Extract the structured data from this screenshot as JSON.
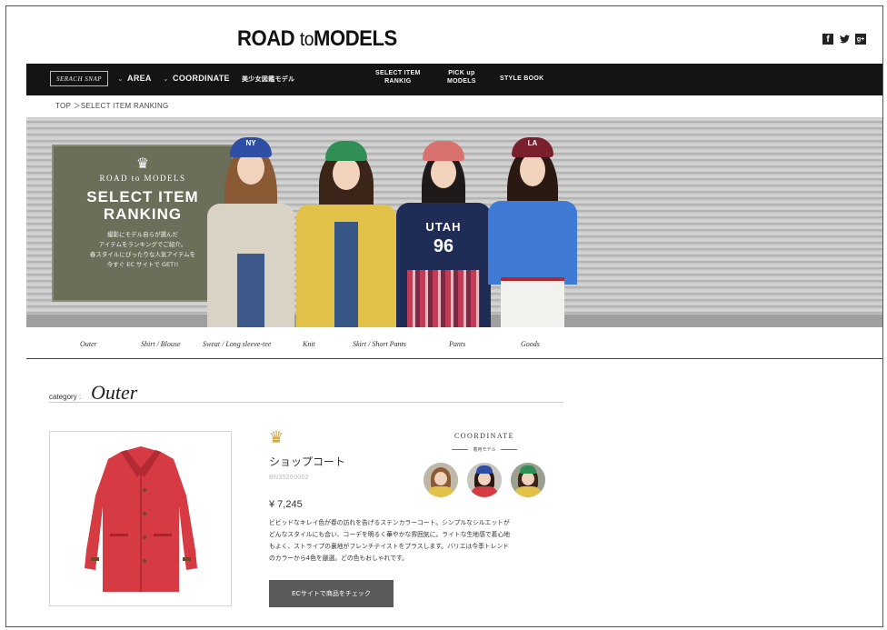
{
  "header": {
    "logo_main": "ROAD",
    "logo_to": "to",
    "logo_end": "MODELS",
    "social": [
      "facebook-icon",
      "twitter-icon",
      "google-plus-icon"
    ],
    "social_glyphs": {
      "facebook": "f",
      "twitter": "🐦",
      "google": "g+"
    }
  },
  "nav": {
    "search_label": "SERACH SNAP",
    "area": "AREA",
    "coordinate": "COORDINATE",
    "pictorial": "美少女図鑑モデル",
    "select_item_line1": "SELECT ITEM",
    "select_item_line2": "RANKIG",
    "pickup_line1": "PICK up",
    "pickup_line2": "MODELS",
    "style_book": "STYLE BOOK"
  },
  "breadcrumb": "TOP ＞SELECT ITEM RANKING",
  "hero": {
    "brand": "ROAD to MODELS",
    "title_line1": "SELECT ITEM",
    "title_line2": "RANKING",
    "desc_line1": "撮影にモデル自らが選んだ",
    "desc_line2": "アイテムをランキングでご紹介。",
    "desc_line3": "春スタイルにぴったりな人気アイテムを",
    "desc_line4": "今すぐ EC サイトで GET!!",
    "cap_ny": "NY",
    "cap_la": "LA",
    "shirt_text1": "UTAH",
    "shirt_text2": "96"
  },
  "categories": [
    "Outer",
    "Shirt / Blouse",
    "Sweat / Long sleeve-tee",
    "Knit",
    "Skirt / Short Pants",
    "Pants",
    "Goods"
  ],
  "section": {
    "label": "category :",
    "name": "Outer"
  },
  "product": {
    "name": "ショップコート",
    "code": "BN35260002",
    "price": "¥ 7,245",
    "desc_line1": "ビビッドなキレイ色が春の訪れを告げるステンカラーコート。シンプルなシルエットが",
    "desc_line2": "どんなスタイルにも合い、コーデを明るく華やかな雰囲気に。ライトな生地感で着心地",
    "desc_line3": "もよく、ストライプの裏地がフレンチテイストをプラスします。バリエは今季トレンド",
    "desc_line4": "のカラーから4色を厳選。どの色もおしゃれです。",
    "button_label": "ECサイトで商品をチェック"
  },
  "coordinate": {
    "title": "COORDINATE",
    "subtitle": "着用モデル"
  },
  "colors": {
    "nav_bg": "#141414",
    "hero_panel": "#6b6e58",
    "coat_red": "#d63a43",
    "crown_gold": "#caa03c",
    "button": "#5a5a5a"
  }
}
